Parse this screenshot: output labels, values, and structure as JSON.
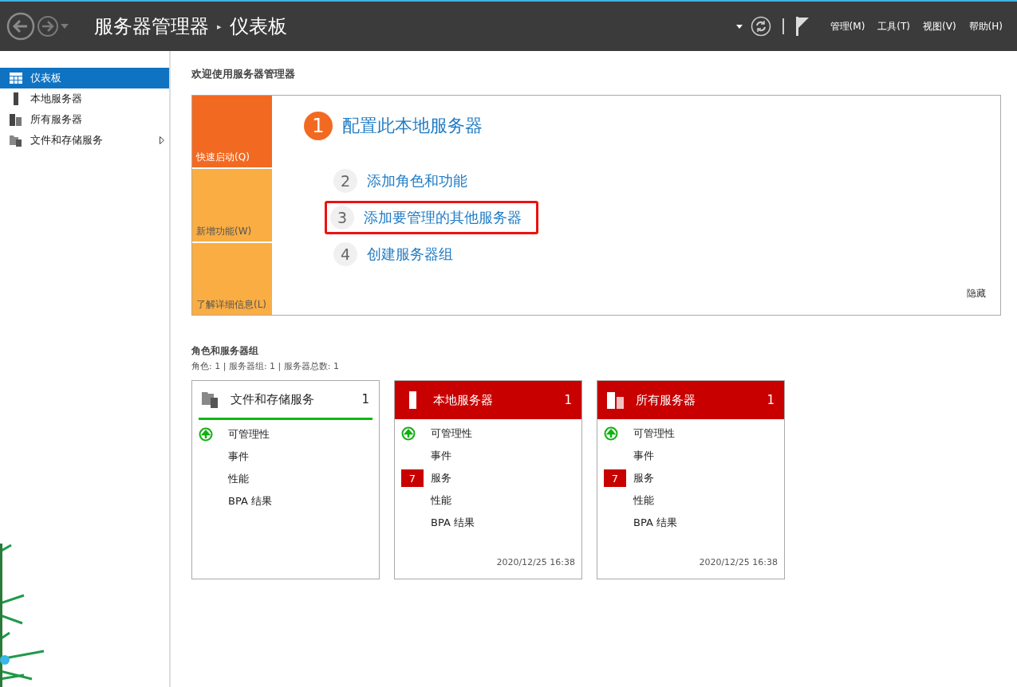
{
  "header": {
    "app_title": "服务器管理器",
    "separator": "▸",
    "page_title": "仪表板",
    "menus": [
      "管理(M)",
      "工具(T)",
      "视图(V)",
      "帮助(H)"
    ]
  },
  "sidebar": {
    "items": [
      {
        "label": "仪表板",
        "kind": "dashboard",
        "selected": true,
        "expandable": false
      },
      {
        "label": "本地服务器",
        "kind": "server",
        "selected": false,
        "expandable": false
      },
      {
        "label": "所有服务器",
        "kind": "servers",
        "selected": false,
        "expandable": false
      },
      {
        "label": "文件和存储服务",
        "kind": "storage",
        "selected": false,
        "expandable": true
      }
    ]
  },
  "welcome": {
    "title": "欢迎使用服务器管理器",
    "tiles": [
      {
        "label": "快速启动(Q)",
        "selected": true
      },
      {
        "label": "新增功能(W)",
        "selected": false
      },
      {
        "label": "了解详细信息(L)",
        "selected": false
      }
    ],
    "steps": [
      {
        "number": "1",
        "label": "配置此本地服务器",
        "kind": "primary",
        "highlighted": false
      },
      {
        "number": "2",
        "label": "添加角色和功能",
        "kind": "secondary",
        "highlighted": false
      },
      {
        "number": "3",
        "label": "添加要管理的其他服务器",
        "kind": "secondary",
        "highlighted": true
      },
      {
        "number": "4",
        "label": "创建服务器组",
        "kind": "secondary",
        "highlighted": false
      }
    ],
    "hide_link": "隐藏"
  },
  "roles": {
    "title": "角色和服务器组",
    "summary": "角色: 1 | 服务器组: 1 | 服务器总数: 1",
    "cards": [
      {
        "title": "文件和存储服务",
        "count": "1",
        "kind": "storage",
        "alert": false,
        "rows": [
          {
            "label": "可管理性",
            "kind": "status"
          },
          {
            "label": "事件",
            "kind": "plain"
          },
          {
            "label": "性能",
            "kind": "plain"
          },
          {
            "label": "BPA 结果",
            "kind": "plain"
          }
        ]
      },
      {
        "title": "本地服务器",
        "count": "1",
        "kind": "server",
        "alert": true,
        "rows": [
          {
            "label": "可管理性",
            "kind": "status"
          },
          {
            "label": "事件",
            "kind": "plain"
          },
          {
            "label": "服务",
            "kind": "alert",
            "badge": "7"
          },
          {
            "label": "性能",
            "kind": "plain"
          },
          {
            "label": "BPA 结果",
            "kind": "plain"
          }
        ],
        "timestamp": "2020/12/25 16:38"
      },
      {
        "title": "所有服务器",
        "count": "1",
        "kind": "servers",
        "alert": true,
        "rows": [
          {
            "label": "可管理性",
            "kind": "status"
          },
          {
            "label": "事件",
            "kind": "plain"
          },
          {
            "label": "服务",
            "kind": "alert",
            "badge": "7"
          },
          {
            "label": "性能",
            "kind": "plain"
          },
          {
            "label": "BPA 结果",
            "kind": "plain"
          }
        ],
        "timestamp": "2020/12/25 16:38"
      }
    ]
  }
}
